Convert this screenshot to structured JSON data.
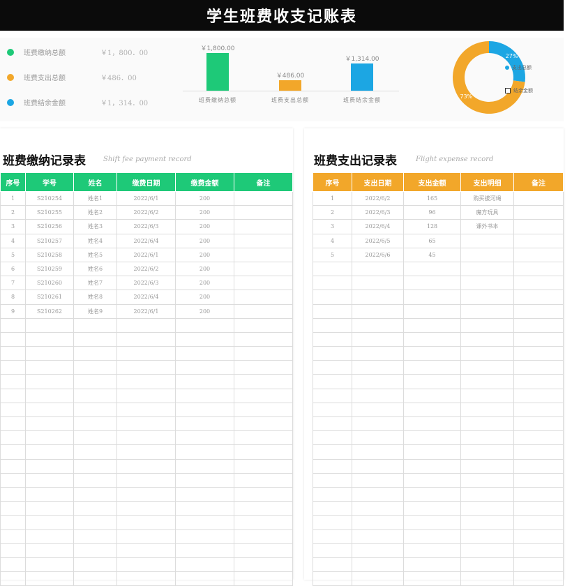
{
  "title": "学生班费收支记账表",
  "summary": [
    {
      "label": "班费缴纳总额",
      "value": "￥1，800．00",
      "color": "#1ec978"
    },
    {
      "label": "班费支出总额",
      "value": "￥486．00",
      "color": "#f2a72a"
    },
    {
      "label": "班费结余金额",
      "value": "￥1，314．00",
      "color": "#1ca6e3"
    }
  ],
  "chart_data": [
    {
      "type": "bar",
      "categories": [
        "班费缴纳总额",
        "班费支出总额",
        "班费结余金额"
      ],
      "values": [
        1800,
        486,
        1314
      ],
      "value_labels": [
        "￥1,800.00",
        "￥486.00",
        "￥1,314.00"
      ],
      "colors": [
        "#1ec978",
        "#f2a72a",
        "#1ca6e3"
      ],
      "ylim": [
        0,
        1800
      ]
    },
    {
      "type": "pie",
      "donut": true,
      "labels": [
        "支出总额",
        "结余金额"
      ],
      "values": [
        27,
        73
      ],
      "value_labels": [
        "27%",
        "73%"
      ],
      "colors": [
        "#1ca6e3",
        "#f2a72a"
      ],
      "legend": "right"
    }
  ],
  "payments": {
    "title": "班费缴纳记录表",
    "subtitle": "Shift fee payment record",
    "color": "#1ec978",
    "headers": [
      "序号",
      "学号",
      "姓名",
      "缴费日期",
      "缴费金额",
      "备注"
    ],
    "rows": [
      [
        "1",
        "S210254",
        "姓名1",
        "2022/6/1",
        "200",
        ""
      ],
      [
        "2",
        "S210255",
        "姓名2",
        "2022/6/2",
        "200",
        ""
      ],
      [
        "3",
        "S210256",
        "姓名3",
        "2022/6/3",
        "200",
        ""
      ],
      [
        "4",
        "S210257",
        "姓名4",
        "2022/6/4",
        "200",
        ""
      ],
      [
        "5",
        "S210258",
        "姓名5",
        "2022/6/1",
        "200",
        ""
      ],
      [
        "6",
        "S210259",
        "姓名6",
        "2022/6/2",
        "200",
        ""
      ],
      [
        "7",
        "S210260",
        "姓名7",
        "2022/6/3",
        "200",
        ""
      ],
      [
        "8",
        "S210261",
        "姓名8",
        "2022/6/4",
        "200",
        ""
      ],
      [
        "9",
        "S210262",
        "姓名9",
        "2022/6/1",
        "200",
        ""
      ]
    ]
  },
  "expenses": {
    "title": "班费支出记录表",
    "subtitle": "Flight expense record",
    "color": "#f2a72a",
    "headers": [
      "序号",
      "支出日期",
      "支出金额",
      "支出明细",
      "备注"
    ],
    "rows": [
      [
        "1",
        "2022/6/2",
        "165",
        "购买拔河绳",
        ""
      ],
      [
        "2",
        "2022/6/3",
        "96",
        "魔方玩具",
        ""
      ],
      [
        "3",
        "2022/6/4",
        "128",
        "课外书本",
        ""
      ],
      [
        "4",
        "2022/6/5",
        "65",
        "",
        ""
      ],
      [
        "5",
        "2022/6/6",
        "45",
        "",
        ""
      ]
    ]
  }
}
